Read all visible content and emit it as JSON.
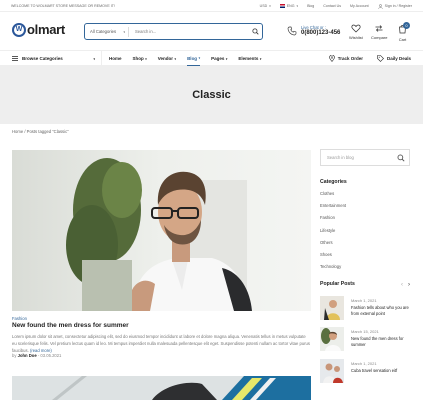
{
  "topbar": {
    "welcome": "Welcome to Wolmart Store message or remove it!",
    "currency": "USD",
    "language": "ENG",
    "links": [
      "Blog",
      "Contact Us",
      "My Account",
      "Sign in / Register"
    ]
  },
  "header": {
    "logo_text": "olmart",
    "logo_mark": "W",
    "search_category": "All Categories",
    "search_placeholder": "Search in...",
    "live_chat_label": "Live Chat or :",
    "phone": "0(800)123-456",
    "wishlist_label": "Wishlist",
    "compare_label": "Compare",
    "cart_label": "Cart",
    "cart_count": "0"
  },
  "nav": {
    "browse_label": "Browse Categories",
    "items": [
      "Home",
      "Shop",
      "Vendor",
      "Blog",
      "Pages",
      "Elements"
    ],
    "active": "Blog",
    "track_order": "Track Order",
    "daily_deals": "Daily Deals"
  },
  "page": {
    "title": "Classic",
    "breadcrumb_home": "Home",
    "breadcrumb_current": "Posts tagged “Classic”"
  },
  "post": {
    "category": "Fashion",
    "title": "New found the men dress for summer",
    "excerpt": "Lorem ipsum dolor sit amet, consectetur adipiscing elit, sed do eiusmod tempor incididunt ut labore et dolore magna aliqua. Venenatis tellus in metus vulputate eu scelerisque felis. Vel pretium lectus quam id leo. Mi tempus imperdiet nulla malesuada pellentesque elit eget. Suspendisse potenti nullam ac tortor vitae purus faucibus.",
    "read_more": "(read more)",
    "by": "by",
    "author": "John Doe",
    "date": "03.05.2021"
  },
  "sidebar": {
    "search_placeholder": "Search in blog",
    "categories_heading": "Categories",
    "categories": [
      "Clothes",
      "Entertainment",
      "Fashion",
      "Lifestyle",
      "Others",
      "Shoes",
      "Technology"
    ],
    "popular_heading": "Popular Posts",
    "popular": [
      {
        "date": "March 1, 2021",
        "title": "Fashion tells about who you are from external point"
      },
      {
        "date": "March 15, 2021",
        "title": "New found the men dress for summer"
      },
      {
        "date": "March 1, 2021",
        "title": "Cuba travel sensation eitf"
      }
    ]
  },
  "colors": {
    "accent": "#336699",
    "band": "#eeeeee"
  }
}
